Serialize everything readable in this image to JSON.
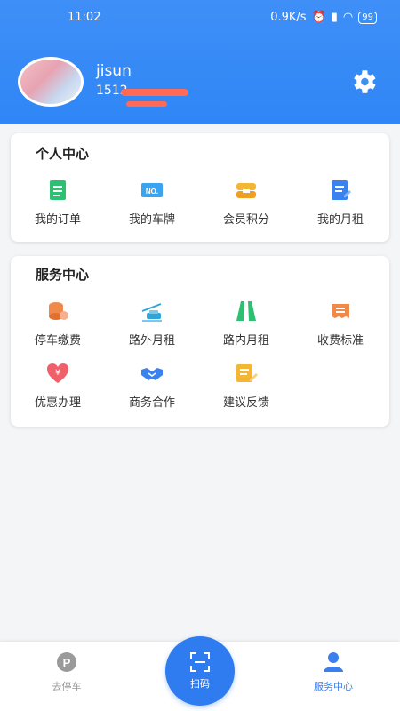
{
  "status_bar": {
    "time": "11:02",
    "speed": "0.9K/s",
    "battery": "99"
  },
  "profile": {
    "username": "jisun",
    "phone": "1512"
  },
  "personal": {
    "title": "个人中心",
    "items": [
      {
        "label": "我的订单",
        "icon": "order-icon",
        "color": "#2fbf71"
      },
      {
        "label": "我的车牌",
        "icon": "plate-icon",
        "color": "#3aa4f0"
      },
      {
        "label": "会员积分",
        "icon": "points-icon",
        "color": "#f4b635"
      },
      {
        "label": "我的月租",
        "icon": "monthly-icon",
        "color": "#3a82f0"
      }
    ]
  },
  "service": {
    "title": "服务中心",
    "items": [
      {
        "label": "停车缴费",
        "icon": "parking-fee-icon",
        "color": "#f08a4b"
      },
      {
        "label": "路外月租",
        "icon": "offroad-icon",
        "color": "#2fa4d8"
      },
      {
        "label": "路内月租",
        "icon": "onroad-icon",
        "color": "#2fbf71"
      },
      {
        "label": "收费标准",
        "icon": "fee-standard-icon",
        "color": "#f08a4b"
      },
      {
        "label": "优惠办理",
        "icon": "discount-icon",
        "color": "#f0606a"
      },
      {
        "label": "商务合作",
        "icon": "handshake-icon",
        "color": "#3a82f0"
      },
      {
        "label": "建议反馈",
        "icon": "feedback-icon",
        "color": "#f4b635"
      }
    ]
  },
  "bottom_nav": {
    "park": "去停车",
    "scan": "扫码",
    "service": "服务中心"
  }
}
